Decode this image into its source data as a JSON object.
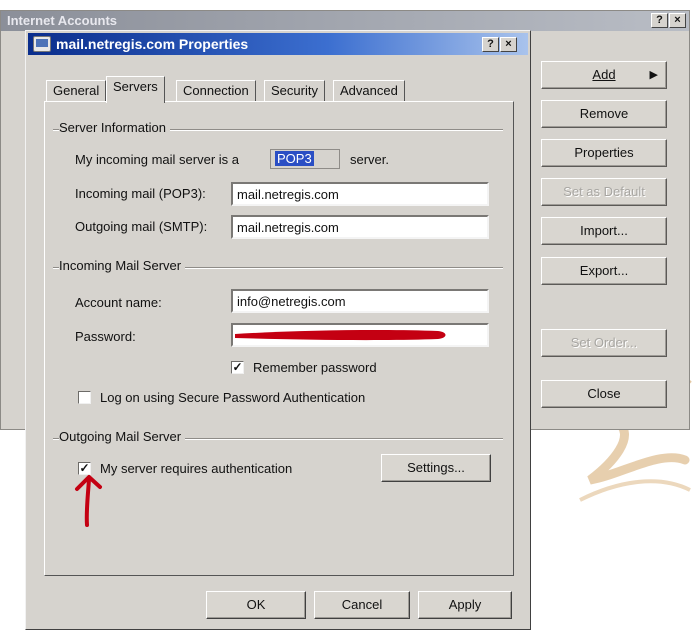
{
  "background_window": {
    "title": "Internet Accounts",
    "help_glyph": "?",
    "close_glyph": "×",
    "buttons": {
      "add": "Add",
      "add_arrow": "▶",
      "remove": "Remove",
      "properties": "Properties",
      "set_default": "Set as Default",
      "import": "Import...",
      "export": "Export...",
      "set_order": "Set Order...",
      "close": "Close"
    }
  },
  "dialog": {
    "title": "mail.netregis.com Properties",
    "help_glyph": "?",
    "close_glyph": "×",
    "tabs": [
      "General",
      "Servers",
      "Connection",
      "Security",
      "Advanced"
    ],
    "active_tab": "Servers",
    "server_info": {
      "group_label": "Server Information",
      "incoming_prefix": "My incoming mail server is a",
      "server_type": "POP3",
      "incoming_suffix": "server.",
      "incoming_label": "Incoming mail (POP3):",
      "incoming_value": "mail.netregis.com",
      "outgoing_label": "Outgoing mail (SMTP):",
      "outgoing_value": "mail.netregis.com"
    },
    "incoming_server": {
      "group_label": "Incoming Mail Server",
      "account_label": "Account name:",
      "account_value": "info@netregis.com",
      "password_label": "Password:",
      "remember_label": "Remember password",
      "remember_checked": true,
      "spa_label": "Log on using Secure Password Authentication",
      "spa_checked": false
    },
    "outgoing_server": {
      "group_label": "Outgoing Mail Server",
      "auth_label": "My server requires authentication",
      "auth_checked": true,
      "settings_button": "Settings..."
    },
    "footer": {
      "ok": "OK",
      "cancel": "Cancel",
      "apply": "Apply"
    }
  },
  "colors": {
    "annotation_red": "#c40012",
    "title_bar": "#0a2d8c",
    "dialog_face": "#d6d3ce"
  }
}
